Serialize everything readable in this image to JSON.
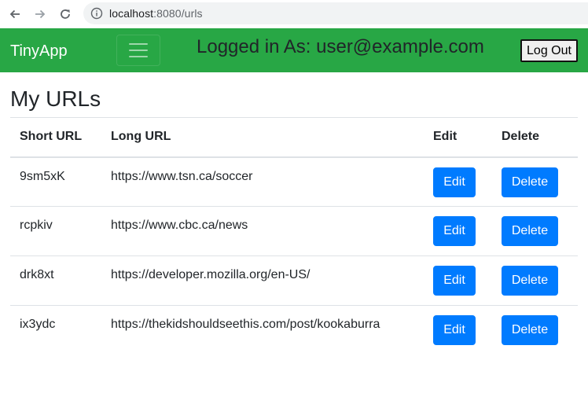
{
  "browser": {
    "url_host": "localhost",
    "url_port_path": ":8080/urls"
  },
  "navbar": {
    "brand": "TinyApp",
    "logged_in_text": "Logged in As: user@example.com",
    "logout_label": "Log Out",
    "background_color": "#28a745"
  },
  "page": {
    "title": "My URLs"
  },
  "table": {
    "headers": {
      "short": "Short URL",
      "long": "Long URL",
      "edit": "Edit",
      "delete": "Delete"
    },
    "rows": [
      {
        "short": "9sm5xK",
        "long": "https://www.tsn.ca/soccer",
        "edit": "Edit",
        "delete": "Delete"
      },
      {
        "short": "rcpkiv",
        "long": "https://www.cbc.ca/news",
        "edit": "Edit",
        "delete": "Delete"
      },
      {
        "short": "drk8xt",
        "long": "https://developer.mozilla.org/en-US/",
        "edit": "Edit",
        "delete": "Delete"
      },
      {
        "short": "ix3ydc",
        "long": "https://thekidshouldseethis.com/post/kookaburra",
        "edit": "Edit",
        "delete": "Delete"
      }
    ]
  },
  "colors": {
    "button_primary": "#007bff",
    "navbar": "#28a745"
  },
  "icons": {
    "back": "arrow-left-icon",
    "forward": "arrow-right-icon",
    "reload": "reload-icon",
    "site_info": "info-icon",
    "menu": "hamburger-menu-icon"
  }
}
